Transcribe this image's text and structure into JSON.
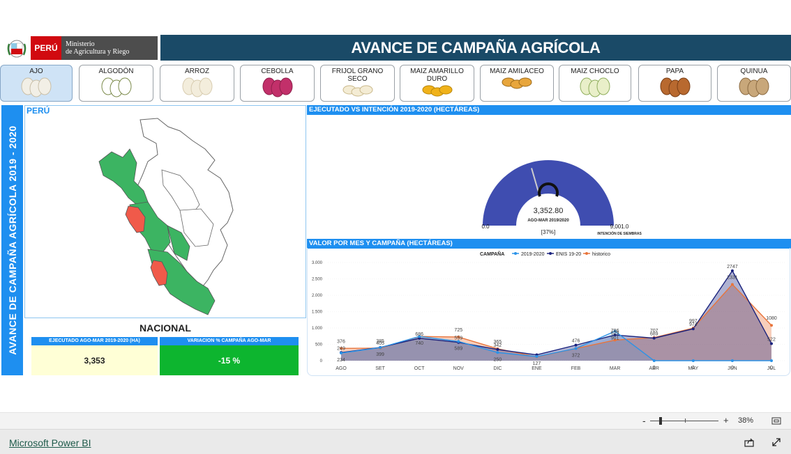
{
  "header": {
    "peru_label": "PERÚ",
    "ministry_line1": "Ministerio",
    "ministry_line2": "de Agricultura y Riego",
    "title": "AVANCE DE CAMPAÑA AGRÍCOLA"
  },
  "crops": [
    {
      "label": "AJO",
      "icon": "garlic-icon",
      "active": true
    },
    {
      "label": "ALGODÓN",
      "icon": "cotton-icon",
      "active": false
    },
    {
      "label": "ARROZ",
      "icon": "rice-icon",
      "active": false
    },
    {
      "label": "CEBOLLA",
      "icon": "onion-icon",
      "active": false
    },
    {
      "label": "FRIJOL GRANO SECO",
      "icon": "beans-icon",
      "active": false
    },
    {
      "label": "MAIZ AMARILLO DURO",
      "icon": "yellow-corn-icon",
      "active": false
    },
    {
      "label": "MAIZ AMILACEO",
      "icon": "starchy-corn-icon",
      "active": false
    },
    {
      "label": "MAIZ CHOCLO",
      "icon": "corn-cob-icon",
      "active": false
    },
    {
      "label": "PAPA",
      "icon": "potato-icon",
      "active": false
    },
    {
      "label": "QUINUA",
      "icon": "quinoa-icon",
      "active": false
    }
  ],
  "left": {
    "banner": "AVANCE DE CAMPAÑA AGRÍCOLA 2019 - 2020",
    "map_title": "PERÚ",
    "nacional": "NACIONAL",
    "kpi1_label": "EJECUTADO AGO-MAR 2019-2020 (HA)",
    "kpi1_value": "3,353",
    "kpi2_label": "VARIACION % CAMPAÑA AGO-MAR",
    "kpi2_value": "-15 %"
  },
  "gauge": {
    "header": "EJECUTADO VS INTENCIÓN 2019-2020 (HECTÁREAS)",
    "value_label": "3,352.80",
    "sub_label": "AGO-MAR 2019/2020",
    "percent": "[37%]",
    "min_label": "0.0",
    "max_label": "9,001.0",
    "max_sub": "INTENCIÓN DE SIEMBRAS",
    "value": 3352.8,
    "max": 9001.0,
    "fill_color": "#3f4db0",
    "target_fraction": 0.41
  },
  "chart_data": {
    "type": "area",
    "title": "VALOR POR MES Y CAMPAÑA (HECTÁREAS)",
    "legend_title": "CAMPAÑA",
    "categories": [
      "AGO",
      "SET",
      "OCT",
      "NOV",
      "DIC",
      "ENE",
      "FEB",
      "MAR",
      "ABR",
      "MAY",
      "JUN",
      "JUL"
    ],
    "y_ticks": [
      "3.000",
      "2.500",
      "2.000",
      "1.500",
      "1.000",
      "500",
      "0"
    ],
    "ylim": [
      0,
      3000
    ],
    "series": [
      {
        "name": "2019-2020",
        "color": "#2b93e8",
        "values": [
          234,
          399,
          740,
          589,
          250,
          127,
          372,
          901,
          0,
          0,
          0,
          0
        ],
        "labels": [
          "234",
          "399",
          "740",
          "589",
          "250",
          "127",
          "372",
          "901",
          "0",
          "0",
          "0",
          "0"
        ]
      },
      {
        "name": "ENIS 19-20",
        "color": "#1a237e",
        "values": [
          249,
          405,
          686,
          559,
          342,
          180,
          476,
          786,
          689,
          974,
          2747,
          522
        ],
        "labels": [
          "249",
          "405",
          "686",
          "559",
          "342",
          "",
          "476",
          "786",
          "689",
          "974",
          "2747",
          "522"
        ]
      },
      {
        "name": "historico",
        "color": "#e8743b",
        "values": [
          376,
          385,
          740,
          725,
          365,
          117,
          372,
          629,
          707,
          997,
          2331,
          1080
        ],
        "labels": [
          "376",
          "385",
          "",
          "725",
          "365",
          "",
          "",
          "629",
          "707",
          "997",
          "2331",
          "1080"
        ]
      }
    ]
  },
  "footer": {
    "link": "Microsoft Power BI",
    "zoom": "38%",
    "minus": "-",
    "plus": "+"
  }
}
